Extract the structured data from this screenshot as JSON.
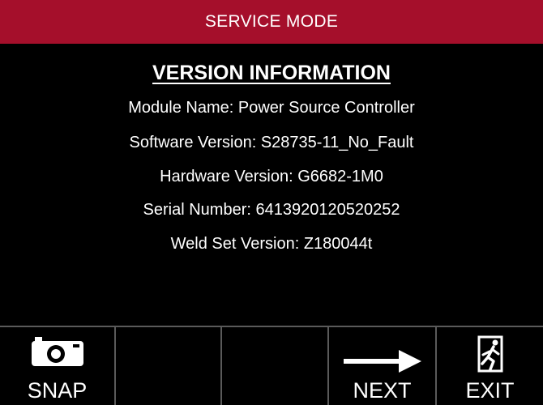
{
  "header": {
    "title": "SERVICE MODE"
  },
  "main": {
    "heading": "VERSION INFORMATION",
    "lines": [
      "Module Name: Power Source Controller",
      "Software Version: S28735-11_No_Fault",
      "Hardware Version: G6682-1M0",
      "Serial Number: 6413920120520252",
      "Weld Set Version: Z180044t"
    ]
  },
  "toolbar": {
    "buttons": [
      {
        "label": "SNAP",
        "icon": "camera-icon"
      },
      {
        "label": "",
        "icon": ""
      },
      {
        "label": "",
        "icon": ""
      },
      {
        "label": "NEXT",
        "icon": "arrow-right-icon"
      },
      {
        "label": "EXIT",
        "icon": "exit-door-icon"
      }
    ]
  },
  "colors": {
    "header_bg": "#a50f2b",
    "background": "#000000",
    "divider": "#5a5a5a"
  }
}
